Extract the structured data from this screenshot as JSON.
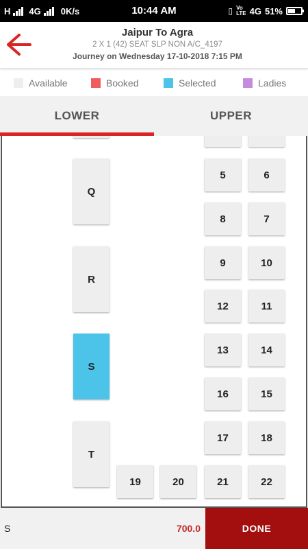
{
  "status_bar": {
    "left_text": "H",
    "network_label": "4G",
    "speed": "0K/s",
    "time": "10:44 AM",
    "right_network": "4G",
    "battery": "51%"
  },
  "header": {
    "title": "Jaipur To Agra",
    "subtitle": "2 X 1 (42) SEAT SLP NON A/C_4197",
    "journey": "Journey on Wednesday 17-10-2018  7:15 PM",
    "back_color": "#d92525"
  },
  "legend": [
    {
      "label": "Available",
      "color": "#eeeeee"
    },
    {
      "label": "Booked",
      "color": "#f25b5b"
    },
    {
      "label": "Selected",
      "color": "#4cc3e9"
    },
    {
      "label": "Ladies",
      "color": "#c48be0"
    }
  ],
  "tabs": {
    "lower": "LOWER",
    "upper": "UPPER",
    "active": "lower"
  },
  "seats": {
    "sleepers": [
      {
        "label": "Q",
        "status": "available"
      },
      {
        "label": "R",
        "status": "available"
      },
      {
        "label": "S",
        "status": "selected"
      },
      {
        "label": "T",
        "status": "available"
      }
    ],
    "rows": [
      [
        "5",
        "6"
      ],
      [
        "8",
        "7"
      ],
      [
        "9",
        "10"
      ],
      [
        "12",
        "11"
      ],
      [
        "13",
        "14"
      ],
      [
        "16",
        "15"
      ],
      [
        "17",
        "18"
      ]
    ],
    "last_row": [
      "19",
      "20",
      "21",
      "22"
    ]
  },
  "footer": {
    "selected_seats": "S",
    "fare": "700.0",
    "done_label": "DONE"
  }
}
